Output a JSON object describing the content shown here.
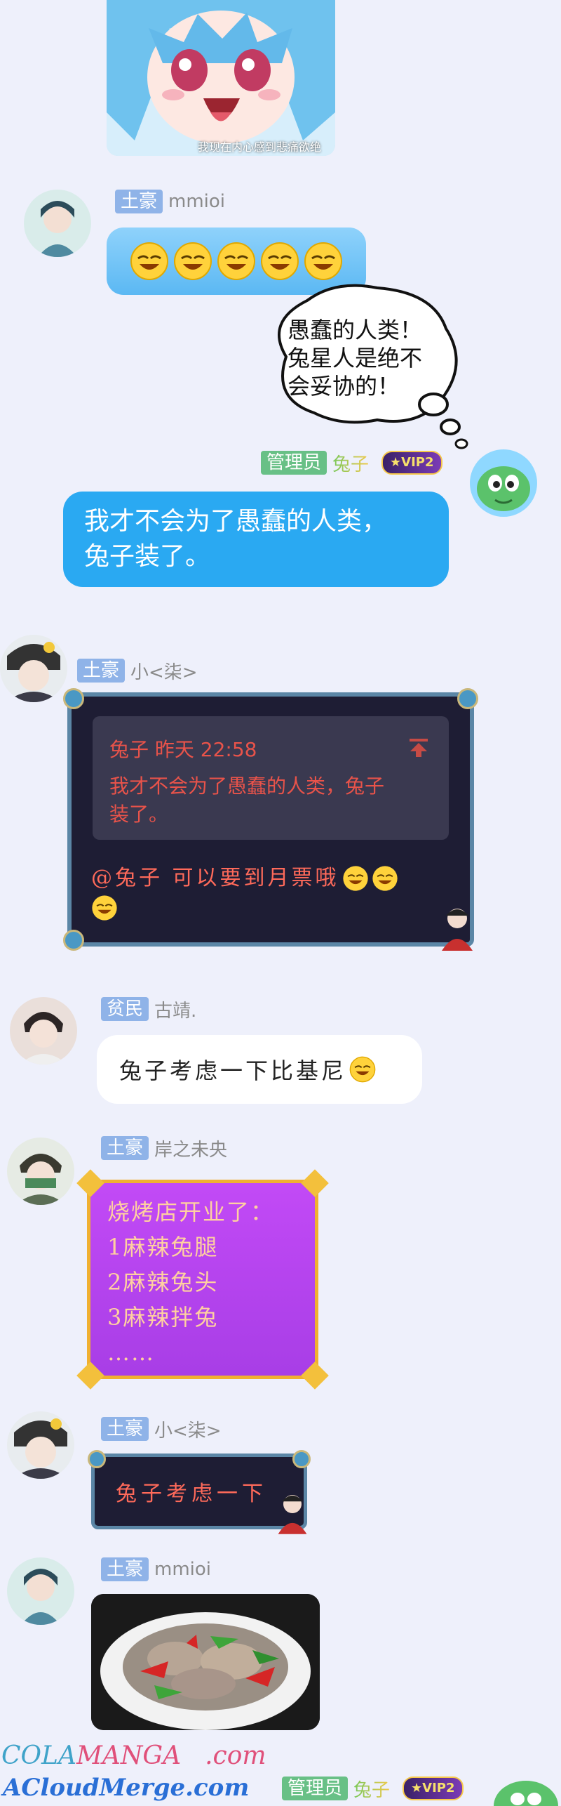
{
  "top_sticker": {
    "caption": "我现在内心感到悲痛欲绝"
  },
  "messages": [
    {
      "badge": "土豪",
      "name": "mmioi"
    },
    {
      "badge": "管理员",
      "name": "兔子",
      "vip": "★VIP2",
      "text_line1": "我才不会为了愚蠢的人类，",
      "text_line2": "兔子装了。"
    },
    {
      "badge": "土豪",
      "name": "小<柒>",
      "quote_meta": "兔子 昨天 22:58",
      "quote_line1": "我才不会为了愚蠢的人类，兔子",
      "quote_line2": "装了。",
      "text_line1": "@兔子 可以要到月票哦",
      "text_line2": ""
    },
    {
      "badge": "贫民",
      "name": "古靖.",
      "text": "兔子考虑一下比基尼"
    },
    {
      "badge": "土豪",
      "name": "岸之未央",
      "lines": [
        "烧烤店开业了：",
        "1麻辣兔腿",
        "2麻辣兔头",
        "3麻辣拌兔",
        "……"
      ]
    },
    {
      "badge": "土豪",
      "name": "小<柒>",
      "text": "兔子考虑一下"
    },
    {
      "badge": "土豪",
      "name": "mmioi"
    },
    {
      "badge": "管理员",
      "name": "兔子",
      "vip": "★VIP2"
    }
  ],
  "thought_bubble": {
    "line1": "愚蠢的人类！",
    "line2": "兔星人是绝不",
    "line3": "会妥协的！"
  },
  "watermark": {
    "line1_a": "COLA",
    "line1_b": "MANGA",
    "line1_c": ".com",
    "line2": "ACloudMerge.com"
  },
  "colors": {
    "bg": "#eef0fb",
    "blue_bubble": "#2aa9f2",
    "badge": "#8fb3e8",
    "admin_badge": "#68c086",
    "purple_card": "#b23cf0"
  },
  "icons": [
    "laughing-emoji-icon",
    "pin-top-icon",
    "corner-gem-icon"
  ]
}
